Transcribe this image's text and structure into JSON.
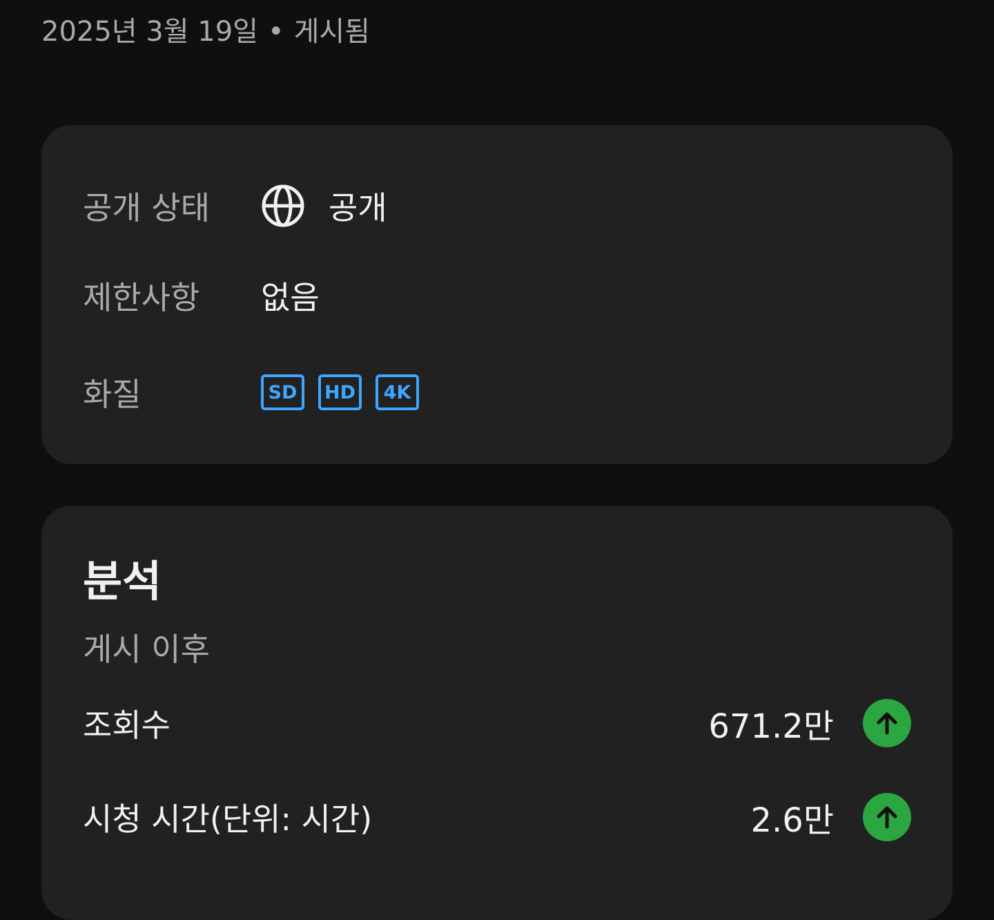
{
  "header": {
    "date": "2025년 3월 19일",
    "separator": "•",
    "status": "게시됨"
  },
  "details": {
    "visibility": {
      "label": "공개 상태",
      "value": "공개",
      "icon": "globe-icon"
    },
    "restrictions": {
      "label": "제한사항",
      "value": "없음"
    },
    "quality": {
      "label": "화질",
      "badges": [
        "SD",
        "HD",
        "4K"
      ]
    }
  },
  "analytics": {
    "title": "분석",
    "subtitle": "게시 이후",
    "metrics": [
      {
        "label": "조회수",
        "value": "671.2만",
        "trend": "up"
      },
      {
        "label": "시청 시간(단위: 시간)",
        "value": "2.6만",
        "trend": "up"
      }
    ]
  },
  "colors": {
    "background": "#0f0f0f",
    "card": "#212121",
    "accent_blue": "#3ea6ff",
    "trend_green": "#2ba640",
    "text_primary": "#f1f1f1",
    "text_secondary": "#aaaaaa"
  }
}
